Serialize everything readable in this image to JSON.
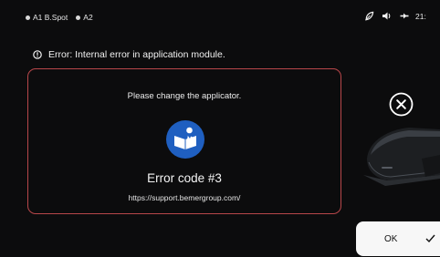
{
  "status_bar": {
    "slots": [
      {
        "label": "A1 B.Spot"
      },
      {
        "label": "A2"
      }
    ],
    "icons": [
      "leaf-icon",
      "speaker-icon",
      "bluetooth-icon"
    ],
    "clock": "21:"
  },
  "error_banner": {
    "icon": "info-circle-icon",
    "text": "Error: Internal error in application module."
  },
  "dialog": {
    "message": "Please change the applicator.",
    "icon": "read-manual-icon",
    "error_code": "Error code #3",
    "support_url": "https://support.bemergroup.com/",
    "border_color": "#b8474a"
  },
  "close_button": {
    "icon": "close-circle-icon"
  },
  "device": {
    "icon": "applicator-device-icon"
  },
  "ok_button": {
    "label": "OK",
    "icon": "check-icon"
  },
  "colors": {
    "background": "#0c0c0d",
    "manual_icon_blue": "#1f5fc0",
    "text": "#f2f2f2"
  }
}
